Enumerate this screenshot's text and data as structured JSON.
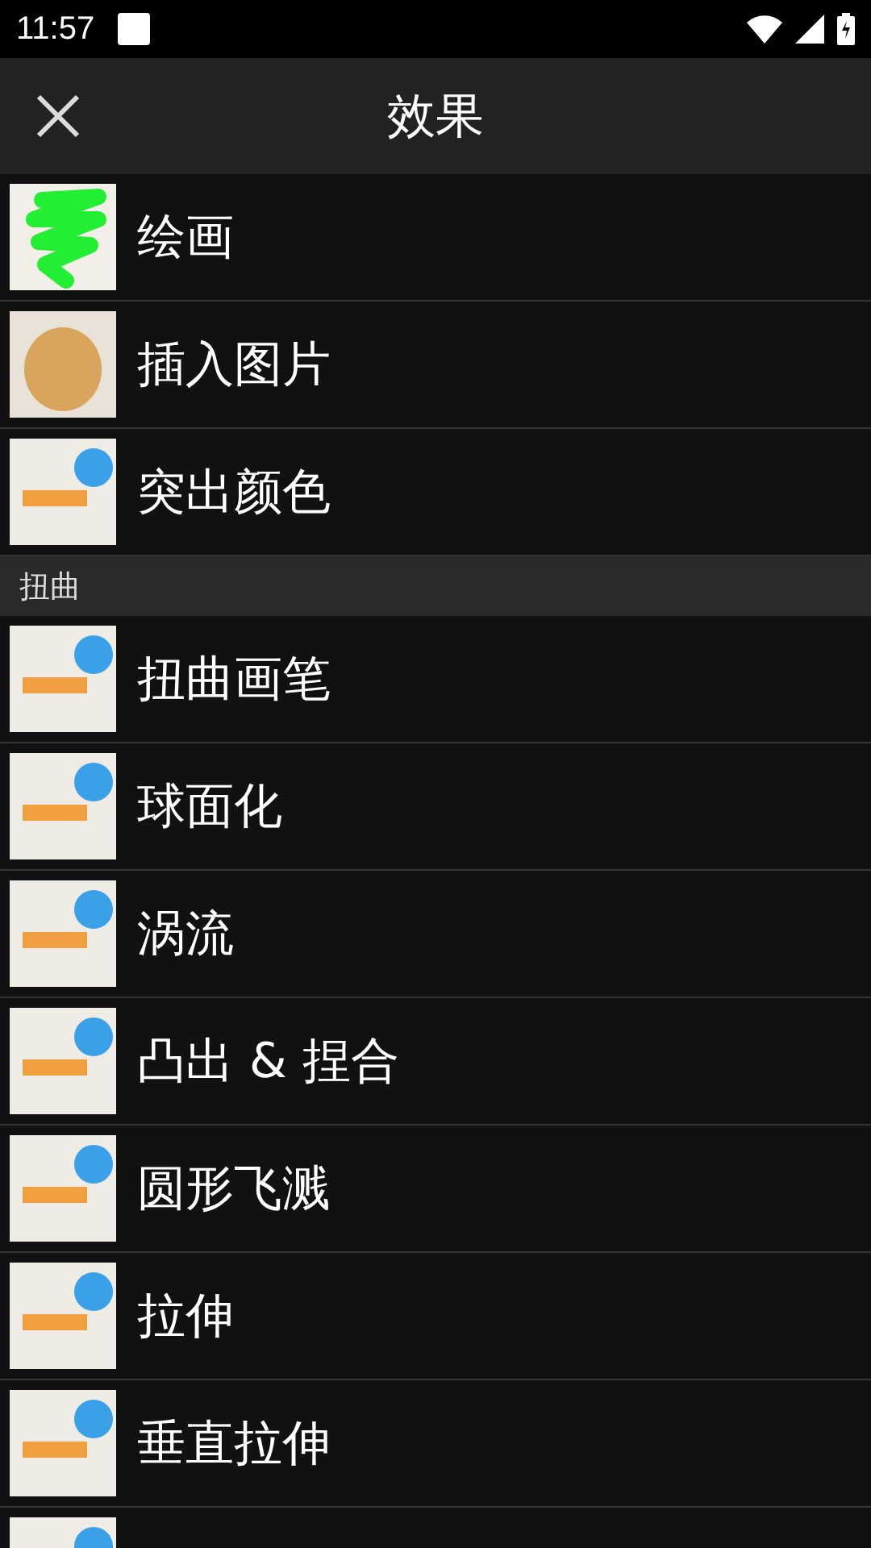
{
  "status_bar": {
    "time": "11:57"
  },
  "header": {
    "title": "效果"
  },
  "sections": [
    {
      "items": [
        {
          "label": "绘画",
          "kind": "scribble"
        },
        {
          "label": "插入图片",
          "kind": "dog"
        },
        {
          "label": "突出颜色",
          "kind": "sample"
        }
      ]
    },
    {
      "title": "扭曲",
      "items": [
        {
          "label": "扭曲画笔",
          "kind": "sample"
        },
        {
          "label": "球面化",
          "kind": "sample"
        },
        {
          "label": "涡流",
          "kind": "sample"
        },
        {
          "label": "凸出 & 捏合",
          "kind": "sample"
        },
        {
          "label": "圆形飞溅",
          "kind": "sample"
        },
        {
          "label": "拉伸",
          "kind": "sample"
        },
        {
          "label": "垂直拉伸",
          "kind": "sample"
        },
        {
          "kind": "sample"
        }
      ]
    }
  ]
}
